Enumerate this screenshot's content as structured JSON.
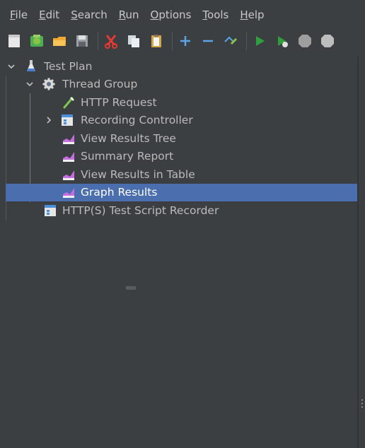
{
  "menu": {
    "items": [
      {
        "mnemonic": "F",
        "rest": "ile"
      },
      {
        "mnemonic": "E",
        "rest": "dit"
      },
      {
        "mnemonic": "S",
        "rest": "earch"
      },
      {
        "mnemonic": "R",
        "rest": "un"
      },
      {
        "mnemonic": "O",
        "rest": "ptions"
      },
      {
        "mnemonic": "T",
        "rest": "ools"
      },
      {
        "mnemonic": "H",
        "rest": "elp"
      }
    ]
  },
  "toolbar": {
    "buttons": [
      "new-icon",
      "templates-icon",
      "open-icon",
      "save-icon",
      "cut-icon",
      "copy-icon",
      "paste-icon",
      "expand-icon",
      "collapse-icon",
      "toggle-icon",
      "start-icon",
      "start-no-pauses-icon",
      "stop-icon",
      "shutdown-icon"
    ]
  },
  "tree": {
    "nodes": [
      {
        "label": "Test Plan",
        "icon": "flask-icon"
      },
      {
        "label": "Thread Group",
        "icon": "gear-icon"
      },
      {
        "label": "HTTP Request",
        "icon": "pipette-icon"
      },
      {
        "label": "Recording Controller",
        "icon": "controller-icon"
      },
      {
        "label": "View Results Tree",
        "icon": "chart-listener-icon"
      },
      {
        "label": "Summary Report",
        "icon": "chart-listener-icon"
      },
      {
        "label": "View Results in Table",
        "icon": "chart-listener-icon"
      },
      {
        "label": "Graph Results",
        "icon": "chart-listener-icon",
        "selected": true
      },
      {
        "label": "HTTP(S) Test Script Recorder",
        "icon": "controller-icon"
      }
    ]
  },
  "colors": {
    "background": "#3c3f41",
    "selection": "#4b6eaf",
    "text": "#bbbbbb"
  }
}
